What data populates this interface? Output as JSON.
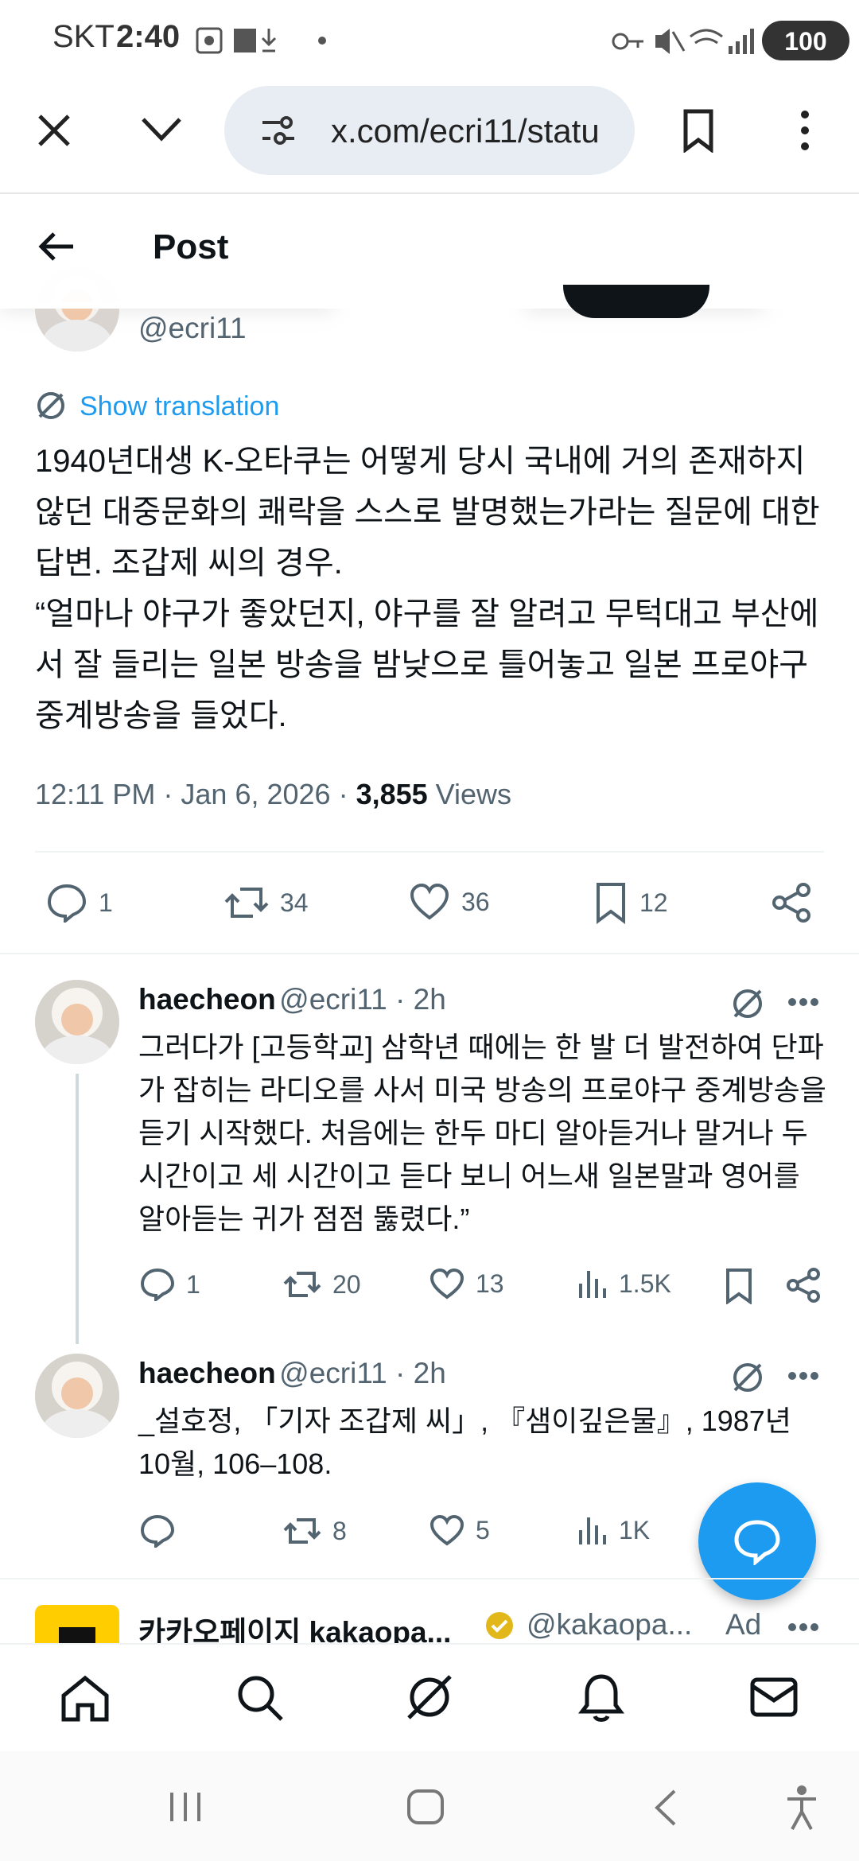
{
  "status_bar": {
    "carrier": "SKT",
    "time": "2:40",
    "battery": "100"
  },
  "browser": {
    "url": "x.com/ecri11/statu"
  },
  "header": {
    "title": "Post"
  },
  "post": {
    "handle": "@ecri11",
    "show_translation": "Show translation",
    "text": "1940년대생 K-오타쿠는 어떻게 당시 국내에 거의 존재하지 않던 대중문화의 쾌락을 스스로 발명했는가라는 질문에 대한 답변. 조갑제 씨의 경우.\n“얼마나 야구가 좋았던지, 야구를 잘 알려고 무턱대고 부산에서 잘 들리는 일본 방송을 밤낮으로 틀어놓고 일본 프로야구 중계방송을 들었다.",
    "meta_time": "12:11 PM · Jan 6, 2026 · ",
    "views_count": "3,855",
    "views_label": " Views",
    "actions": {
      "replies": "1",
      "reposts": "34",
      "likes": "36",
      "bookmarks": "12"
    }
  },
  "replies": [
    {
      "name": "haecheon",
      "handle": "@ecri11 · 2h",
      "text": "그러다가 [고등학교] 삼학년 때에는 한 발 더 발전하여 단파가 잡히는 라디오를 사서 미국 방송의 프로야구 중계방송을 듣기 시작했다. 처음에는 한두 마디 알아듣거나 말거나 두 시간이고 세 시간이고 듣다 보니 어느새 일본말과 영어를 알아듣는 귀가 점점 뚫렸다.”",
      "replies": "1",
      "reposts": "20",
      "likes": "13",
      "views": "1.5K"
    },
    {
      "name": "haecheon",
      "handle": "@ecri11 · 2h",
      "text": "_설호정, 「기자 조갑제 씨」, 『샘이깊은물』, 1987년 10월, 106–108.",
      "replies": "",
      "reposts": "8",
      "likes": "5",
      "views": "1K"
    }
  ],
  "ad": {
    "name": "카카오페이지 kakaopa...",
    "handle": "@kakaopa...",
    "label": "Ad"
  },
  "colors": {
    "accent": "#1d9bf0",
    "text": "#0f1419",
    "muted": "#536471"
  }
}
